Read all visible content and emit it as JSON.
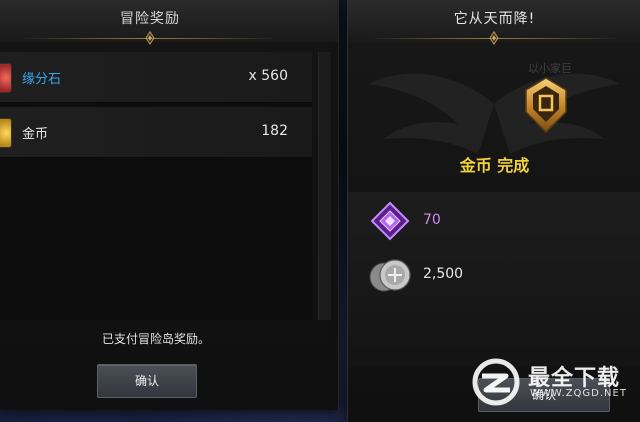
{
  "left_panel": {
    "title": "冒险奖励",
    "rewards": [
      {
        "name": "缘分石",
        "qty": "x 560",
        "name_color": "#35a6f0",
        "icon": "fate-stone-icon"
      },
      {
        "name": "金币",
        "qty": "182",
        "name_color": "#e8e8e8",
        "icon": "gold-coin-icon"
      }
    ],
    "message": "已支付冒险岛奖励。",
    "confirm_label": "确认"
  },
  "right_panel": {
    "title": "它从天而降!",
    "faded_text": "以小家巨",
    "emblem_icon": "gold-medal-emblem-icon",
    "complete_text": "金币 完成",
    "rewards": [
      {
        "value": "70",
        "color": "#c88df0",
        "icon": "purple-crystal-icon"
      },
      {
        "value": "2,500",
        "color": "#e8e8e8",
        "icon": "silver-coin-icon"
      }
    ],
    "confirm_label": "确认"
  },
  "watermark": {
    "brand": "最全下载",
    "url": "WWW.ZQGD.NET"
  },
  "colors": {
    "accent_gold": "#f2d23a",
    "ornament": "#9a7f45"
  }
}
